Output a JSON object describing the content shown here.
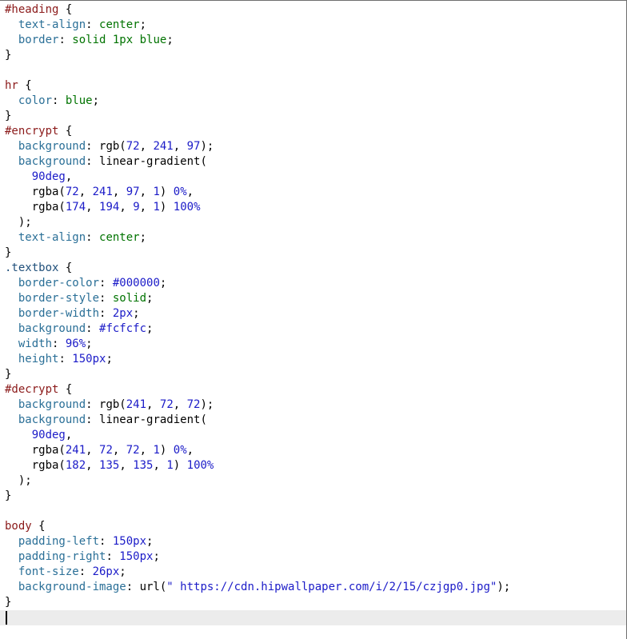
{
  "editor": {
    "lines": [
      [
        {
          "t": "#heading",
          "c": "selector"
        },
        {
          "t": " {",
          "c": "punct"
        }
      ],
      [
        {
          "t": "  ",
          "c": "punct"
        },
        {
          "t": "text-align",
          "c": "prop"
        },
        {
          "t": ": ",
          "c": "punct"
        },
        {
          "t": "center",
          "c": "val"
        },
        {
          "t": ";",
          "c": "punct"
        }
      ],
      [
        {
          "t": "  ",
          "c": "punct"
        },
        {
          "t": "border",
          "c": "prop"
        },
        {
          "t": ": ",
          "c": "punct"
        },
        {
          "t": "solid 1px blue",
          "c": "val"
        },
        {
          "t": ";",
          "c": "punct"
        }
      ],
      [
        {
          "t": "}",
          "c": "punct"
        }
      ],
      [],
      [
        {
          "t": "hr",
          "c": "selector"
        },
        {
          "t": " {",
          "c": "punct"
        }
      ],
      [
        {
          "t": "  ",
          "c": "punct"
        },
        {
          "t": "color",
          "c": "prop"
        },
        {
          "t": ": ",
          "c": "punct"
        },
        {
          "t": "blue",
          "c": "val"
        },
        {
          "t": ";",
          "c": "punct"
        }
      ],
      [
        {
          "t": "}",
          "c": "punct"
        }
      ],
      [
        {
          "t": "#encrypt",
          "c": "selector"
        },
        {
          "t": " {",
          "c": "punct"
        }
      ],
      [
        {
          "t": "  ",
          "c": "punct"
        },
        {
          "t": "background",
          "c": "prop"
        },
        {
          "t": ": ",
          "c": "punct"
        },
        {
          "t": "rgb(",
          "c": "fn"
        },
        {
          "t": "72",
          "c": "num"
        },
        {
          "t": ", ",
          "c": "punct"
        },
        {
          "t": "241",
          "c": "num"
        },
        {
          "t": ", ",
          "c": "punct"
        },
        {
          "t": "97",
          "c": "num"
        },
        {
          "t": ");",
          "c": "punct"
        }
      ],
      [
        {
          "t": "  ",
          "c": "punct"
        },
        {
          "t": "background",
          "c": "prop"
        },
        {
          "t": ": ",
          "c": "punct"
        },
        {
          "t": "linear-gradient(",
          "c": "fn"
        }
      ],
      [
        {
          "t": "    ",
          "c": "punct"
        },
        {
          "t": "90deg",
          "c": "num"
        },
        {
          "t": ",",
          "c": "punct"
        }
      ],
      [
        {
          "t": "    ",
          "c": "punct"
        },
        {
          "t": "rgba(",
          "c": "fn"
        },
        {
          "t": "72",
          "c": "num"
        },
        {
          "t": ", ",
          "c": "punct"
        },
        {
          "t": "241",
          "c": "num"
        },
        {
          "t": ", ",
          "c": "punct"
        },
        {
          "t": "97",
          "c": "num"
        },
        {
          "t": ", ",
          "c": "punct"
        },
        {
          "t": "1",
          "c": "num"
        },
        {
          "t": ") ",
          "c": "punct"
        },
        {
          "t": "0%",
          "c": "num"
        },
        {
          "t": ",",
          "c": "punct"
        }
      ],
      [
        {
          "t": "    ",
          "c": "punct"
        },
        {
          "t": "rgba(",
          "c": "fn"
        },
        {
          "t": "174",
          "c": "num"
        },
        {
          "t": ", ",
          "c": "punct"
        },
        {
          "t": "194",
          "c": "num"
        },
        {
          "t": ", ",
          "c": "punct"
        },
        {
          "t": "9",
          "c": "num"
        },
        {
          "t": ", ",
          "c": "punct"
        },
        {
          "t": "1",
          "c": "num"
        },
        {
          "t": ") ",
          "c": "punct"
        },
        {
          "t": "100%",
          "c": "num"
        }
      ],
      [
        {
          "t": "  );",
          "c": "punct"
        }
      ],
      [
        {
          "t": "  ",
          "c": "punct"
        },
        {
          "t": "text-align",
          "c": "prop"
        },
        {
          "t": ": ",
          "c": "punct"
        },
        {
          "t": "center",
          "c": "val"
        },
        {
          "t": ";",
          "c": "punct"
        }
      ],
      [
        {
          "t": "}",
          "c": "punct"
        }
      ],
      [
        {
          "t": ".textbox",
          "c": "class"
        },
        {
          "t": " {",
          "c": "punct"
        }
      ],
      [
        {
          "t": "  ",
          "c": "punct"
        },
        {
          "t": "border-color",
          "c": "prop"
        },
        {
          "t": ": ",
          "c": "punct"
        },
        {
          "t": "#000000",
          "c": "num"
        },
        {
          "t": ";",
          "c": "punct"
        }
      ],
      [
        {
          "t": "  ",
          "c": "punct"
        },
        {
          "t": "border-style",
          "c": "prop"
        },
        {
          "t": ": ",
          "c": "punct"
        },
        {
          "t": "solid",
          "c": "val"
        },
        {
          "t": ";",
          "c": "punct"
        }
      ],
      [
        {
          "t": "  ",
          "c": "punct"
        },
        {
          "t": "border-width",
          "c": "prop"
        },
        {
          "t": ": ",
          "c": "punct"
        },
        {
          "t": "2px",
          "c": "num"
        },
        {
          "t": ";",
          "c": "punct"
        }
      ],
      [
        {
          "t": "  ",
          "c": "punct"
        },
        {
          "t": "background",
          "c": "prop"
        },
        {
          "t": ": ",
          "c": "punct"
        },
        {
          "t": "#fcfcfc",
          "c": "num"
        },
        {
          "t": ";",
          "c": "punct"
        }
      ],
      [
        {
          "t": "  ",
          "c": "punct"
        },
        {
          "t": "width",
          "c": "prop"
        },
        {
          "t": ": ",
          "c": "punct"
        },
        {
          "t": "96%",
          "c": "num"
        },
        {
          "t": ";",
          "c": "punct"
        }
      ],
      [
        {
          "t": "  ",
          "c": "punct"
        },
        {
          "t": "height",
          "c": "prop"
        },
        {
          "t": ": ",
          "c": "punct"
        },
        {
          "t": "150px",
          "c": "num"
        },
        {
          "t": ";",
          "c": "punct"
        }
      ],
      [
        {
          "t": "}",
          "c": "punct"
        }
      ],
      [
        {
          "t": "#decrypt",
          "c": "selector"
        },
        {
          "t": " {",
          "c": "punct"
        }
      ],
      [
        {
          "t": "  ",
          "c": "punct"
        },
        {
          "t": "background",
          "c": "prop"
        },
        {
          "t": ": ",
          "c": "punct"
        },
        {
          "t": "rgb(",
          "c": "fn"
        },
        {
          "t": "241",
          "c": "num"
        },
        {
          "t": ", ",
          "c": "punct"
        },
        {
          "t": "72",
          "c": "num"
        },
        {
          "t": ", ",
          "c": "punct"
        },
        {
          "t": "72",
          "c": "num"
        },
        {
          "t": ");",
          "c": "punct"
        }
      ],
      [
        {
          "t": "  ",
          "c": "punct"
        },
        {
          "t": "background",
          "c": "prop"
        },
        {
          "t": ": ",
          "c": "punct"
        },
        {
          "t": "linear-gradient(",
          "c": "fn"
        }
      ],
      [
        {
          "t": "    ",
          "c": "punct"
        },
        {
          "t": "90deg",
          "c": "num"
        },
        {
          "t": ",",
          "c": "punct"
        }
      ],
      [
        {
          "t": "    ",
          "c": "punct"
        },
        {
          "t": "rgba(",
          "c": "fn"
        },
        {
          "t": "241",
          "c": "num"
        },
        {
          "t": ", ",
          "c": "punct"
        },
        {
          "t": "72",
          "c": "num"
        },
        {
          "t": ", ",
          "c": "punct"
        },
        {
          "t": "72",
          "c": "num"
        },
        {
          "t": ", ",
          "c": "punct"
        },
        {
          "t": "1",
          "c": "num"
        },
        {
          "t": ") ",
          "c": "punct"
        },
        {
          "t": "0%",
          "c": "num"
        },
        {
          "t": ",",
          "c": "punct"
        }
      ],
      [
        {
          "t": "    ",
          "c": "punct"
        },
        {
          "t": "rgba(",
          "c": "fn"
        },
        {
          "t": "182",
          "c": "num"
        },
        {
          "t": ", ",
          "c": "punct"
        },
        {
          "t": "135",
          "c": "num"
        },
        {
          "t": ", ",
          "c": "punct"
        },
        {
          "t": "135",
          "c": "num"
        },
        {
          "t": ", ",
          "c": "punct"
        },
        {
          "t": "1",
          "c": "num"
        },
        {
          "t": ") ",
          "c": "punct"
        },
        {
          "t": "100%",
          "c": "num"
        }
      ],
      [
        {
          "t": "  );",
          "c": "punct"
        }
      ],
      [
        {
          "t": "}",
          "c": "punct"
        }
      ],
      [],
      [
        {
          "t": "body",
          "c": "selector"
        },
        {
          "t": " {",
          "c": "punct"
        }
      ],
      [
        {
          "t": "  ",
          "c": "punct"
        },
        {
          "t": "padding-left",
          "c": "prop"
        },
        {
          "t": ": ",
          "c": "punct"
        },
        {
          "t": "150px",
          "c": "num"
        },
        {
          "t": ";",
          "c": "punct"
        }
      ],
      [
        {
          "t": "  ",
          "c": "punct"
        },
        {
          "t": "padding-right",
          "c": "prop"
        },
        {
          "t": ": ",
          "c": "punct"
        },
        {
          "t": "150px",
          "c": "num"
        },
        {
          "t": ";",
          "c": "punct"
        }
      ],
      [
        {
          "t": "  ",
          "c": "punct"
        },
        {
          "t": "font-size",
          "c": "prop"
        },
        {
          "t": ": ",
          "c": "punct"
        },
        {
          "t": "26px",
          "c": "num"
        },
        {
          "t": ";",
          "c": "punct"
        }
      ],
      [
        {
          "t": "  ",
          "c": "punct"
        },
        {
          "t": "background-image",
          "c": "prop"
        },
        {
          "t": ": ",
          "c": "punct"
        },
        {
          "t": "url(",
          "c": "fn"
        },
        {
          "t": "\" https://cdn.hipwallpaper.com/i/2/15/czjgp0.jpg\"",
          "c": "str"
        },
        {
          "t": ");",
          "c": "punct"
        }
      ],
      [
        {
          "t": "}",
          "c": "punct"
        }
      ],
      []
    ]
  }
}
